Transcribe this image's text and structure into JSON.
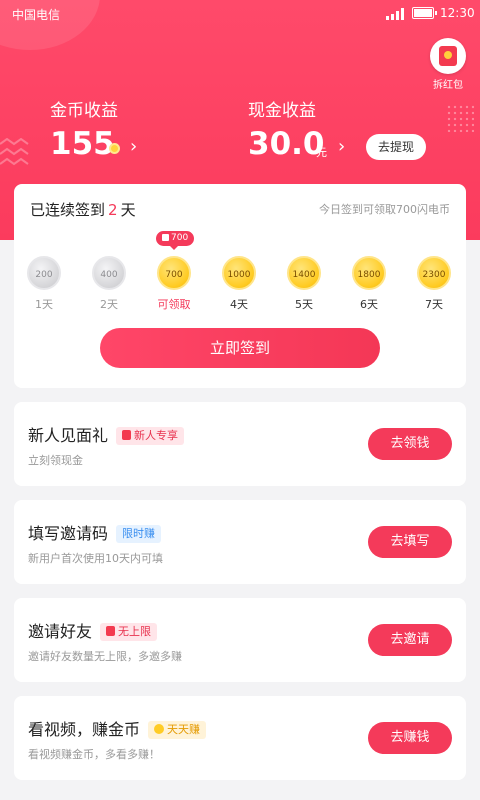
{
  "status_bar": {
    "carrier": "中国电信",
    "time": "12:30"
  },
  "red_packet": {
    "label": "拆红包",
    "icon": "red-envelope-icon"
  },
  "earnings": {
    "coin_label": "金币收益",
    "coin_value": "155",
    "cash_label": "现金收益",
    "cash_value": "30.0",
    "cash_unit": "元",
    "withdraw_label": "去提现"
  },
  "checkin": {
    "title_prefix": "已连续签到",
    "days": "2",
    "title_suffix": "天",
    "hint": "今日签到可领取700闪电币",
    "tooltip": "700",
    "items": [
      {
        "amount": "200",
        "label": "1天",
        "state": "done"
      },
      {
        "amount": "400",
        "label": "2天",
        "state": "done"
      },
      {
        "amount": "700",
        "label": "可领取",
        "state": "today"
      },
      {
        "amount": "1000",
        "label": "4天",
        "state": "future"
      },
      {
        "amount": "1400",
        "label": "5天",
        "state": "future"
      },
      {
        "amount": "1800",
        "label": "6天",
        "state": "future"
      },
      {
        "amount": "2300",
        "label": "7天",
        "state": "future"
      }
    ],
    "button": "立即签到"
  },
  "tasks": [
    {
      "title": "新人见面礼",
      "badge": "新人专享",
      "badge_style": "red",
      "desc": "立刻领现金",
      "button": "去领钱"
    },
    {
      "title": "填写邀请码",
      "badge": "限时赚",
      "badge_style": "blue",
      "desc": "新用户首次使用10天内可填",
      "button": "去填写"
    },
    {
      "title": "邀请好友",
      "badge": "无上限",
      "badge_style": "red",
      "desc": "邀请好友数量无上限，多邀多赚",
      "button": "去邀请"
    },
    {
      "title": "看视频，赚金币",
      "badge": "天天赚",
      "badge_style": "gold",
      "desc": "看视频赚金币，多看多赚！",
      "button": "去赚钱"
    }
  ],
  "colors": {
    "accent": "#f43a5a",
    "coin": "#ffcc26"
  }
}
